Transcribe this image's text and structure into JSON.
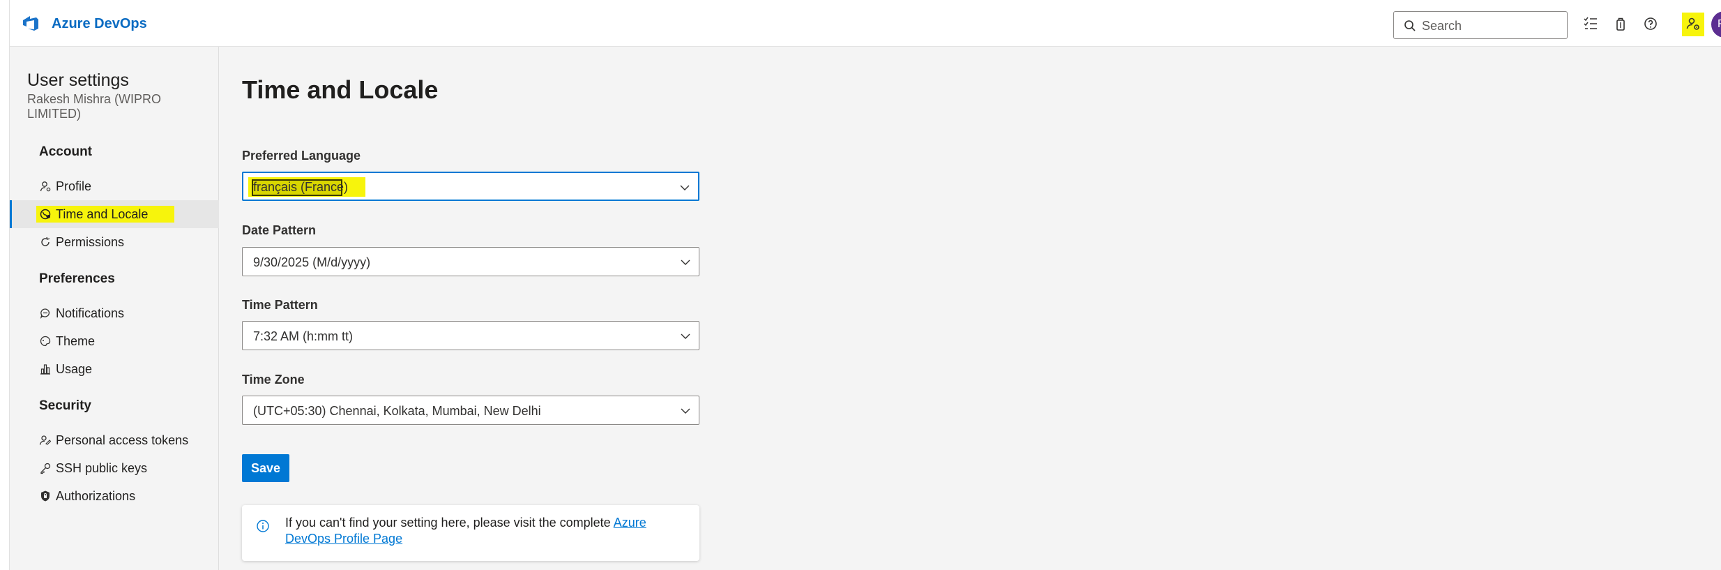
{
  "header": {
    "brand": "Azure DevOps",
    "search_placeholder": "Search",
    "avatar_initials": "RM"
  },
  "sidebar": {
    "title": "User settings",
    "subtitle": "Rakesh Mishra (WIPRO LIMITED)",
    "sections": {
      "account": "Account",
      "preferences": "Preferences",
      "security": "Security"
    },
    "items": [
      {
        "label": "Profile",
        "icon": "profile-icon"
      },
      {
        "label": "Time and Locale",
        "icon": "globe-icon",
        "selected": true
      },
      {
        "label": "Permissions",
        "icon": "refresh-icon"
      },
      {
        "label": "Notifications",
        "icon": "chat-icon"
      },
      {
        "label": "Theme",
        "icon": "palette-icon"
      },
      {
        "label": "Usage",
        "icon": "usage-icon"
      },
      {
        "label": "Personal access tokens",
        "icon": "people-icon"
      },
      {
        "label": "SSH public keys",
        "icon": "key-icon"
      },
      {
        "label": "Authorizations",
        "icon": "shield-icon"
      }
    ]
  },
  "main": {
    "title": "Time and Locale",
    "fields": {
      "language": {
        "label": "Preferred Language",
        "value": "français (France)"
      },
      "date": {
        "label": "Date Pattern",
        "value": "9/30/2025 (M/d/yyyy)"
      },
      "time": {
        "label": "Time Pattern",
        "value": "7:32 AM (h:mm tt)"
      },
      "timezone": {
        "label": "Time Zone",
        "value": "(UTC+05:30) Chennai, Kolkata, Mumbai, New Delhi"
      }
    },
    "save_label": "Save",
    "info": {
      "text": "If you can't find your setting here, please visit the complete ",
      "link": "Azure DevOps Profile Page"
    }
  },
  "colors": {
    "accent": "#0078d4",
    "brand": "#0a6bc2",
    "highlight": "#f7f40c",
    "avatar": "#5c2e91"
  }
}
